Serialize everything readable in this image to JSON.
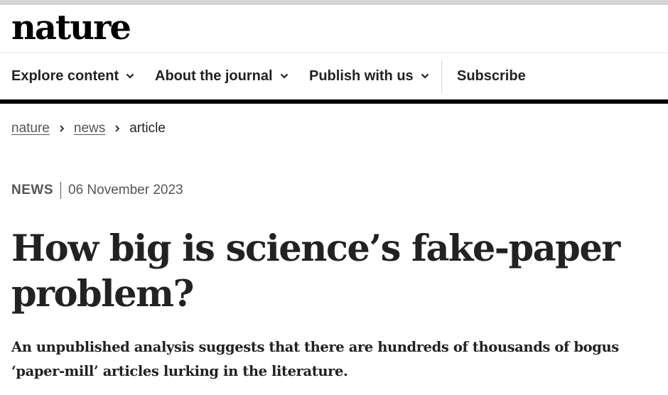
{
  "site": {
    "logo": "nature"
  },
  "nav": {
    "items": [
      {
        "label": "Explore content",
        "icon": "chevron-down-icon"
      },
      {
        "label": "About the journal",
        "icon": "chevron-down-icon"
      },
      {
        "label": "Publish with us",
        "icon": "chevron-down-icon"
      },
      {
        "label": "Subscribe"
      }
    ]
  },
  "breadcrumb": {
    "items": [
      {
        "label": "nature",
        "link": true
      },
      {
        "label": "news",
        "link": true
      },
      {
        "label": "article",
        "link": false
      }
    ],
    "separator_icon": "chevron-right-icon"
  },
  "article": {
    "type": "NEWS",
    "date": "06 November 2023",
    "title": "How big is science’s fake-paper problem?",
    "standfirst": "An unpublished analysis suggests that there are hundreds of thousands of bogus ‘paper-mill’ articles lurking in the literature."
  },
  "colors": {
    "text": "#222222",
    "muted": "#555555",
    "nav_rule": "#000000"
  }
}
